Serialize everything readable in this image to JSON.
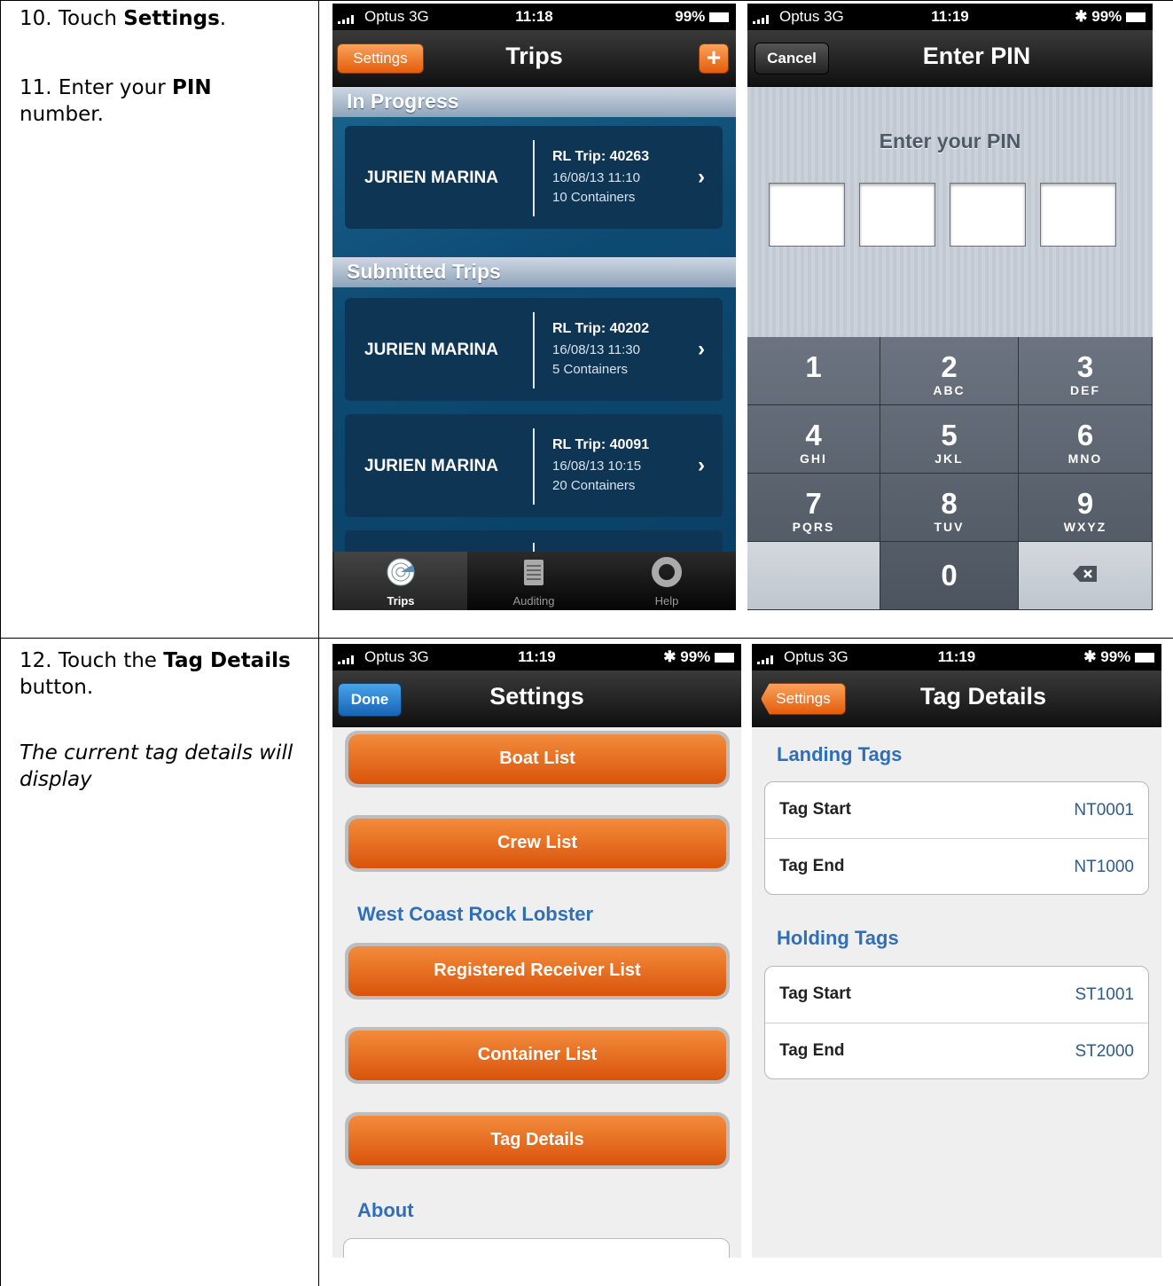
{
  "instructions": {
    "step10_prefix": "10. Touch ",
    "step10_bold": "Settings",
    "step10_suffix": ".",
    "step11_prefix": "11. Enter your ",
    "step11_bold": "PIN",
    "step11_suffix": "number.",
    "step12_prefix": "12. Touch the ",
    "step12_bold": "Tag Details",
    "step12_suffix": "button.",
    "step12_note": "The current tag details will display"
  },
  "status_bar": {
    "carrier": "Optus  3G",
    "battery": "99%",
    "time_trips": "11:18",
    "time_other": "11:19"
  },
  "trips_screen": {
    "settings_button": "Settings",
    "title": "Trips",
    "add_button": "+",
    "section_in_progress": "In Progress",
    "section_submitted": "Submitted Trips",
    "trips": [
      {
        "location": "JURIEN MARINA",
        "trip": "RL Trip: 40263",
        "datetime": "16/08/13 11:10",
        "containers": "10 Containers"
      },
      {
        "location": "JURIEN MARINA",
        "trip": "RL Trip: 40202",
        "datetime": "16/08/13 11:30",
        "containers": "5 Containers"
      },
      {
        "location": "JURIEN MARINA",
        "trip": "RL Trip: 40091",
        "datetime": "16/08/13 10:15",
        "containers": "20 Containers"
      }
    ],
    "tabs": [
      {
        "label": "Trips",
        "icon": "radar-icon"
      },
      {
        "label": "Auditing",
        "icon": "notepad-icon"
      },
      {
        "label": "Help",
        "icon": "lifebuoy-icon"
      }
    ]
  },
  "pin_screen": {
    "cancel_button": "Cancel",
    "title": "Enter PIN",
    "prompt": "Enter your PIN",
    "keys": [
      {
        "num": "1",
        "letters": ""
      },
      {
        "num": "2",
        "letters": "ABC"
      },
      {
        "num": "3",
        "letters": "DEF"
      },
      {
        "num": "4",
        "letters": "GHI"
      },
      {
        "num": "5",
        "letters": "JKL"
      },
      {
        "num": "6",
        "letters": "MNO"
      },
      {
        "num": "7",
        "letters": "PQRS"
      },
      {
        "num": "8",
        "letters": "TUV"
      },
      {
        "num": "9",
        "letters": "WXYZ"
      },
      {
        "num": "0",
        "letters": ""
      }
    ]
  },
  "settings_screen": {
    "done_button": "Done",
    "title": "Settings",
    "boat_list": "Boat List",
    "crew_list": "Crew List",
    "section_wcrl": "West Coast Rock Lobster",
    "registered_receiver_list": "Registered Receiver List",
    "container_list": "Container List",
    "tag_details": "Tag Details",
    "section_about": "About"
  },
  "tag_screen": {
    "back_button": "Settings",
    "title": "Tag Details",
    "landing_header": "Landing Tags",
    "holding_header": "Holding Tags",
    "landing": [
      {
        "label": "Tag Start",
        "value": "NT0001"
      },
      {
        "label": "Tag End",
        "value": "NT1000"
      }
    ],
    "holding": [
      {
        "label": "Tag Start",
        "value": "ST1001"
      },
      {
        "label": "Tag End",
        "value": "ST2000"
      }
    ]
  },
  "colors": {
    "accent_orange": "#e8701e",
    "link_blue": "#2f6fb7",
    "card_navy": "#0e3554"
  }
}
